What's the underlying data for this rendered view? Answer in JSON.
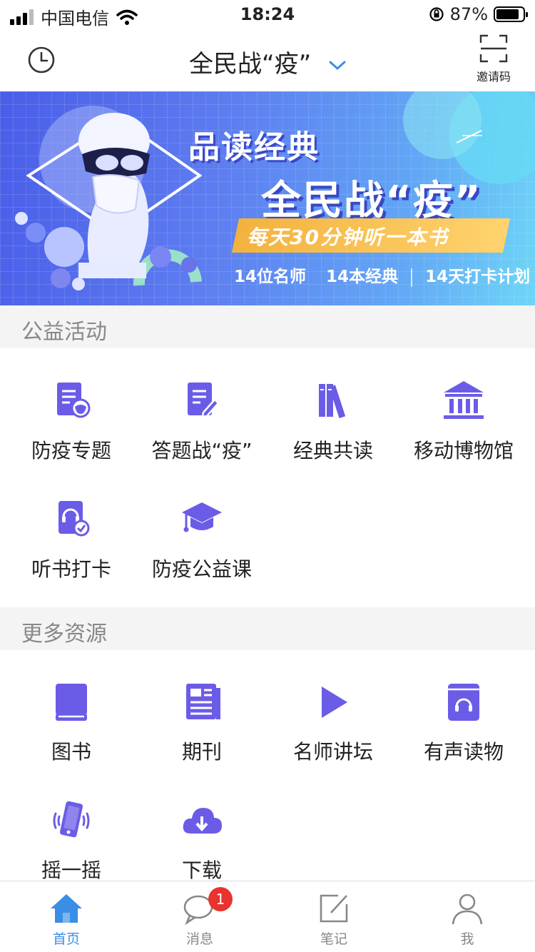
{
  "status_bar": {
    "carrier": "中国电信",
    "time": "18:24",
    "battery": "87%",
    "battery_level": 0.87
  },
  "nav": {
    "title": "全民战“疫”",
    "invite_label": "邀请码"
  },
  "banner": {
    "line1": "品读经典",
    "line2": "全民战“疫”",
    "tagline": "每天30分钟听一本书",
    "stat1": "14位名师",
    "stat2": "14本经典",
    "stat3": "14天打卡计划"
  },
  "section1": {
    "title": "公益活动",
    "items": [
      {
        "label": "防疫专题",
        "icon": "document-mask-icon"
      },
      {
        "label": "答题战“疫”",
        "icon": "quiz-document-icon"
      },
      {
        "label": "经典共读",
        "icon": "books-icon"
      },
      {
        "label": "移动博物馆",
        "icon": "museum-icon"
      },
      {
        "label": "听书打卡",
        "icon": "audiobook-check-icon"
      },
      {
        "label": "防疫公益课",
        "icon": "graduation-cap-icon"
      }
    ]
  },
  "section2": {
    "title": "更多资源",
    "items": [
      {
        "label": "图书",
        "icon": "book-icon"
      },
      {
        "label": "期刊",
        "icon": "journal-icon"
      },
      {
        "label": "名师讲坛",
        "icon": "play-icon"
      },
      {
        "label": "有声读物",
        "icon": "audio-book-icon"
      },
      {
        "label": "摇一摇",
        "icon": "shake-phone-icon"
      },
      {
        "label": "下载",
        "icon": "cloud-download-icon"
      }
    ]
  },
  "tabs": [
    {
      "label": "首页",
      "icon": "home-icon",
      "active": true
    },
    {
      "label": "消息",
      "icon": "message-icon",
      "badge": "1"
    },
    {
      "label": "笔记",
      "icon": "note-icon"
    },
    {
      "label": "我",
      "icon": "profile-icon"
    }
  ],
  "colors": {
    "accent": "#6b5ce7",
    "tab_active": "#3a8ee6",
    "badge": "#e8332f"
  }
}
